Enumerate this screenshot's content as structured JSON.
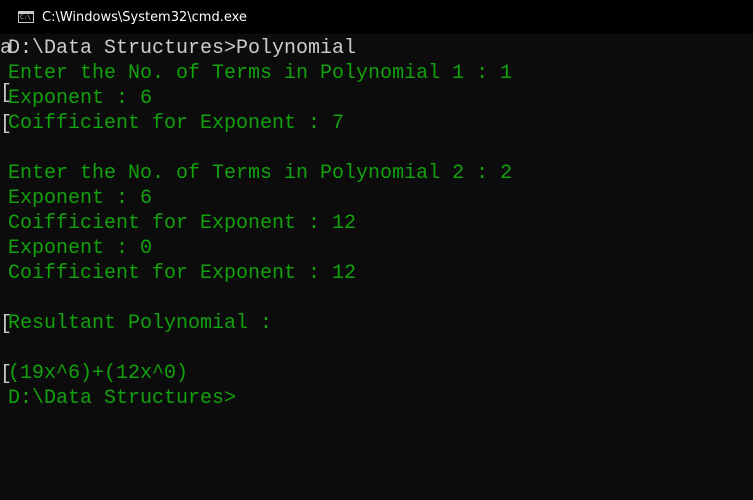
{
  "window": {
    "title": "C:\\Windows\\System32\\cmd.exe",
    "icon": "cmd-icon",
    "icon_text": "C:\\"
  },
  "console": {
    "text_color": "#13a10e",
    "prompt_color": "#cccccc",
    "background": "#0c0c0c",
    "lines": [
      "D:\\Data Structures>Polynomial",
      "Enter the No. of Terms in Polynomial 1 : 1",
      "Exponent : 6",
      "Coifficient for Exponent : 7",
      "",
      "Enter the No. of Terms in Polynomial 2 : 2",
      "Exponent : 6",
      "Coifficient for Exponent : 12",
      "Exponent : 0",
      "Coifficient for Exponent : 12",
      "",
      "Resultant Polynomial :",
      "",
      "(19x^6)+(12x^0)",
      "D:\\Data Structures>"
    ],
    "edge_glyphs": [
      "a",
      "[",
      "[",
      "[",
      "["
    ]
  }
}
